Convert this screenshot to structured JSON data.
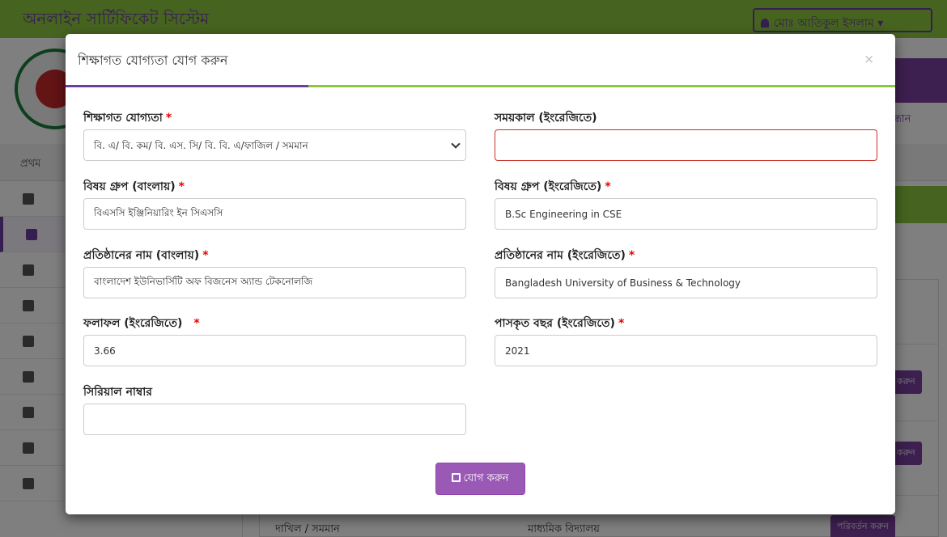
{
  "app": {
    "brand": "অনলাইন সার্টিফিকেট সিস্টেম",
    "user_name": "মোঃ আতিকুল ইসলাম",
    "search_link": "অনুসন্ধান",
    "breadcrumb": "প্রথম",
    "background_rows": {
      "row1_col1": "দাখিল / সমমান",
      "row1_col2": "মাধ্যমিক বিদ্যালয়",
      "edit_label": "পরিবর্তন করুন",
      "edit_short": "করুন"
    }
  },
  "colors": {
    "purple": "#6b3fa0",
    "green": "#8cc63f",
    "required": "#e00000",
    "error_border": "#c9302c"
  },
  "modal": {
    "title": "শিক্ষাগত যোগ্যতা যোগ করুন",
    "close_label": "×",
    "fields": {
      "qualification": {
        "label": "শিক্ষাগত যোগ্যতা",
        "required": "*",
        "value": "বি. এ/ বি. কম/ বি. এস. সি/ বি. বি. এ/ফাজিল / সমমান"
      },
      "duration_en": {
        "label": "সময়কাল (ইংরেজিতে)",
        "value": "",
        "placeholder": ""
      },
      "subject_bn": {
        "label": "বিষয় গ্রুপ (বাংলায়)",
        "required": "*",
        "value": "বিএসসি ইঞ্জিনিয়ারিং ইন সিএসসি"
      },
      "subject_en": {
        "label": "বিষয় গ্রুপ (ইংরেজিতে)",
        "required": "*",
        "value": "B.Sc Engineering in CSE"
      },
      "institution_bn": {
        "label": "প্রতিষ্ঠানের নাম (বাংলায়)",
        "required": "*",
        "value": "বাংলাদেশ ইউনিভার্সিটি অফ বিজনেস অ্যান্ড টেকনোলজি"
      },
      "institution_en": {
        "label": "প্রতিষ্ঠানের নাম (ইংরেজিতে)",
        "required": "*",
        "value": "Bangladesh University of Business & Technology"
      },
      "result_en": {
        "label": "ফলাফল (ইংরেজিতে)",
        "required": "*",
        "value": "3.66"
      },
      "passing_year_en": {
        "label": "পাসকৃত বছর (ইংরেজিতে)",
        "required": "*",
        "value": "2021"
      },
      "serial_number": {
        "label": "সিরিয়াল নাম্বার",
        "value": ""
      }
    },
    "submit_label": "যোগ করুন"
  }
}
